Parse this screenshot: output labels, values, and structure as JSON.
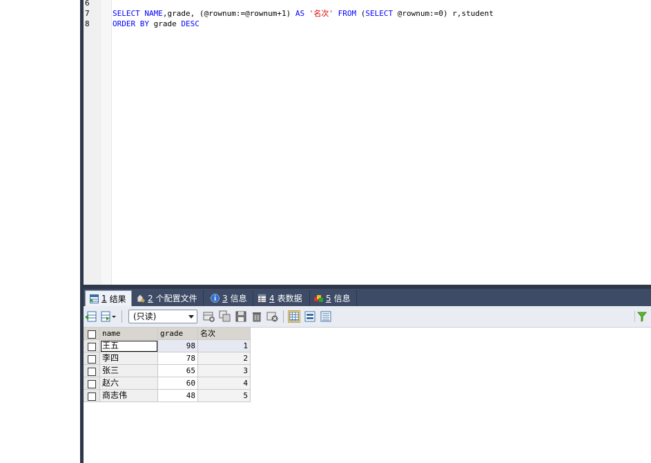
{
  "editor": {
    "lines": [
      {
        "num": "6",
        "tokens": []
      },
      {
        "num": "7",
        "tokens": [
          {
            "t": "SELECT NAME",
            "c": "kw"
          },
          {
            "t": ",grade, (@rownum:=@rownum+1) ",
            "c": "pl"
          },
          {
            "t": "AS",
            "c": "kw"
          },
          {
            "t": " '名次' ",
            "c": "str"
          },
          {
            "t": "FROM",
            "c": "kw"
          },
          {
            "t": " (",
            "c": "pl"
          },
          {
            "t": "SELECT",
            "c": "kw"
          },
          {
            "t": " @rownum:=0) r,student",
            "c": "pl"
          }
        ]
      },
      {
        "num": "8",
        "tokens": [
          {
            "t": "ORDER BY",
            "c": "kw"
          },
          {
            "t": " grade ",
            "c": "pl"
          },
          {
            "t": "DESC",
            "c": "kw"
          }
        ]
      }
    ]
  },
  "tabs": [
    {
      "num": "1",
      "label": "结果",
      "icon": "table-result-icon",
      "active": true
    },
    {
      "num": "2",
      "label": "个配置文件",
      "icon": "profile-icon",
      "active": false
    },
    {
      "num": "3",
      "label": "信息",
      "icon": "info-icon",
      "active": false
    },
    {
      "num": "4",
      "label": "表数据",
      "icon": "table-data-icon",
      "active": false
    },
    {
      "num": "5",
      "label": "信息",
      "icon": "info-color-icon",
      "active": false
    }
  ],
  "toolbar": {
    "mode_select": "(只读)"
  },
  "grid": {
    "columns": [
      "name",
      "grade",
      "名次"
    ],
    "rows": [
      {
        "name": "王五",
        "grade": "98",
        "rank": "1"
      },
      {
        "name": "李四",
        "grade": "78",
        "rank": "2"
      },
      {
        "name": "张三",
        "grade": "65",
        "rank": "3"
      },
      {
        "name": "赵六",
        "grade": "60",
        "rank": "4"
      },
      {
        "name": "商志伟",
        "grade": "48",
        "rank": "5"
      }
    ]
  }
}
